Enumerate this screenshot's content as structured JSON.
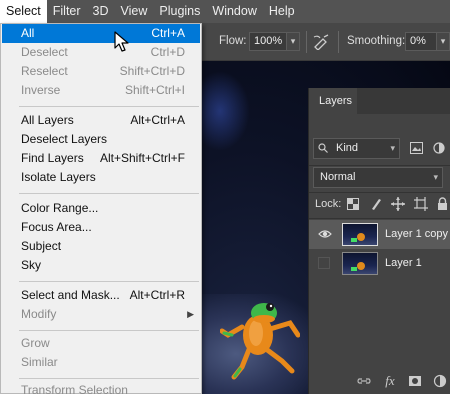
{
  "menubar": {
    "items": [
      "Select",
      "Filter",
      "3D",
      "View",
      "Plugins",
      "Window",
      "Help"
    ],
    "active": "Select"
  },
  "options_bar": {
    "flow_label": "Flow:",
    "flow_value": "100%",
    "smoothing_label": "Smoothing:",
    "smoothing_value": "0%"
  },
  "select_menu": {
    "groups": [
      [
        {
          "label": "All",
          "shortcut": "Ctrl+A",
          "state": "highlighted"
        },
        {
          "label": "Deselect",
          "shortcut": "Ctrl+D",
          "state": "disabled"
        },
        {
          "label": "Reselect",
          "shortcut": "Shift+Ctrl+D",
          "state": "disabled"
        },
        {
          "label": "Inverse",
          "shortcut": "Shift+Ctrl+I",
          "state": "disabled"
        }
      ],
      [
        {
          "label": "All Layers",
          "shortcut": "Alt+Ctrl+A",
          "state": "enabled"
        },
        {
          "label": "Deselect Layers",
          "shortcut": "",
          "state": "enabled"
        },
        {
          "label": "Find Layers",
          "shortcut": "Alt+Shift+Ctrl+F",
          "state": "enabled"
        },
        {
          "label": "Isolate Layers",
          "shortcut": "",
          "state": "enabled"
        }
      ],
      [
        {
          "label": "Color Range...",
          "shortcut": "",
          "state": "enabled"
        },
        {
          "label": "Focus Area...",
          "shortcut": "",
          "state": "enabled"
        },
        {
          "label": "Subject",
          "shortcut": "",
          "state": "enabled"
        },
        {
          "label": "Sky",
          "shortcut": "",
          "state": "enabled"
        }
      ],
      [
        {
          "label": "Select and Mask...",
          "shortcut": "Alt+Ctrl+R",
          "state": "enabled"
        },
        {
          "label": "Modify",
          "shortcut": "",
          "state": "disabled",
          "submenu": true
        }
      ],
      [
        {
          "label": "Grow",
          "shortcut": "",
          "state": "disabled"
        },
        {
          "label": "Similar",
          "shortcut": "",
          "state": "disabled"
        }
      ],
      [
        {
          "label": "Transform Selection",
          "shortcut": "",
          "state": "disabled"
        }
      ]
    ]
  },
  "layers_panel": {
    "tab_label": "Layers",
    "filter_kind": "Kind",
    "blend_mode": "Normal",
    "lock_label": "Lock:",
    "layers": [
      {
        "name": "Layer 1 copy",
        "visible": true,
        "selected": true
      },
      {
        "name": "Layer 1",
        "visible": false,
        "selected": false
      }
    ]
  },
  "colors": {
    "menu_highlight": "#0078d7",
    "menubar_bg": "#535353",
    "panel_bg": "#434343",
    "frog_orange": "#e8891a",
    "frog_green": "#3fb84a"
  }
}
